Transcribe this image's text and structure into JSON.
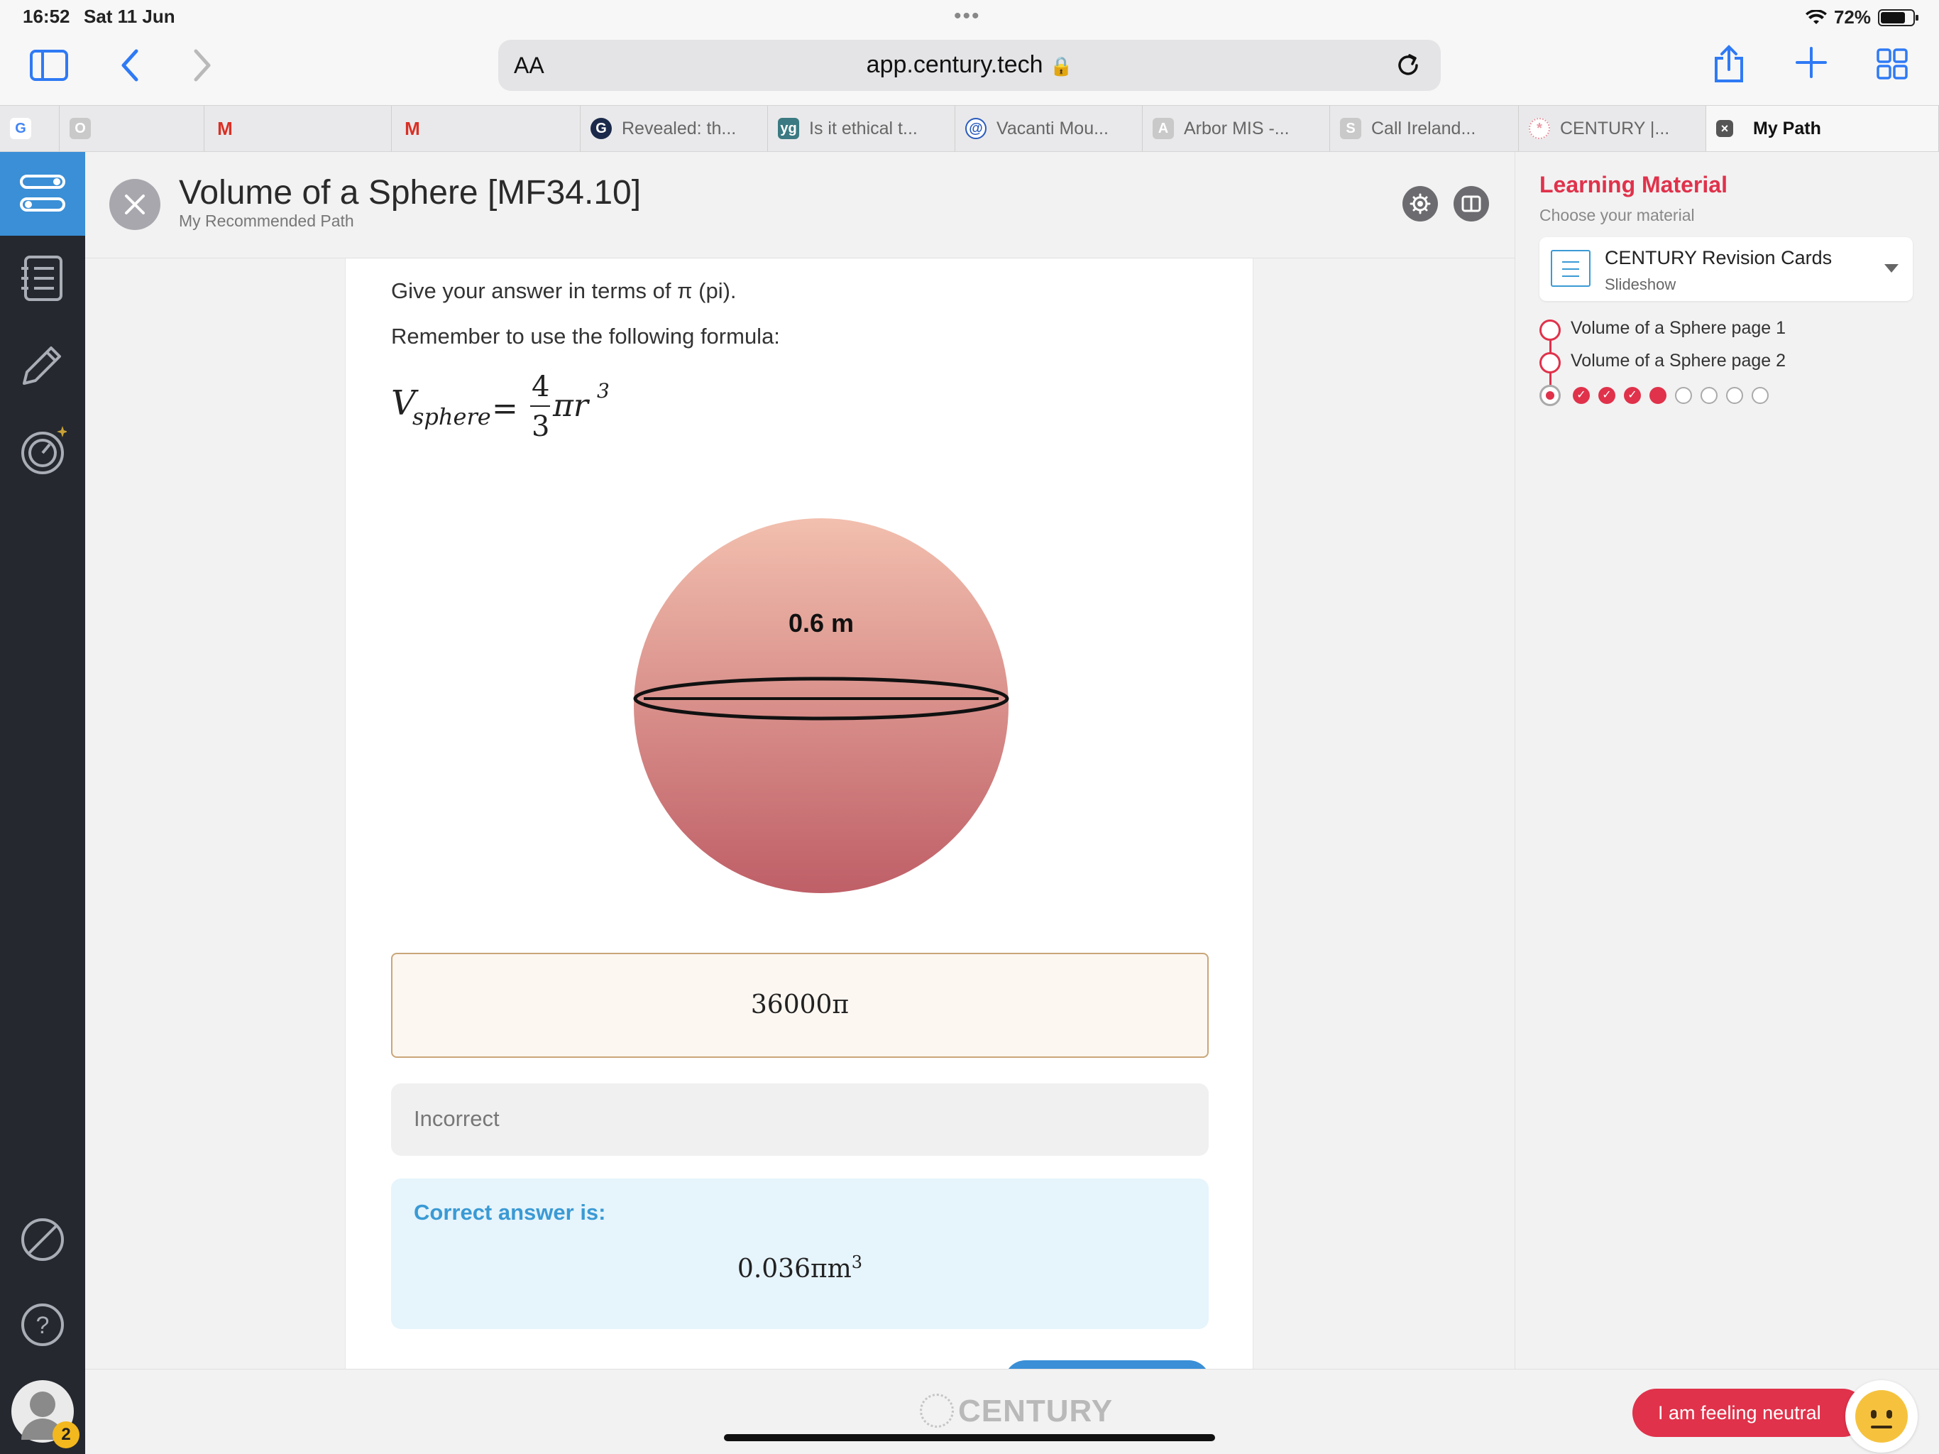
{
  "status": {
    "time": "16:52",
    "date": "Sat 11 Jun",
    "battery": "72%"
  },
  "browser": {
    "aa_label": "AA",
    "url": "app.century.tech",
    "tabs": [
      {
        "label": "",
        "fav": "G",
        "fav_color": "#ffffff"
      },
      {
        "label": "",
        "fav": "O",
        "fav_color": "#bdbdbd"
      },
      {
        "label": "",
        "fav": "M",
        "fav_color": "#ffffff"
      },
      {
        "label": "",
        "fav": "M",
        "fav_color": "#ffffff"
      },
      {
        "label": "Revealed: th...",
        "fav": "G",
        "fav_color": "#1b2a4a"
      },
      {
        "label": "Is it ethical t...",
        "fav": "yg",
        "fav_color": "#3b7a82"
      },
      {
        "label": "Vacanti Mou...",
        "fav": "@",
        "fav_color": "#2a5bbd"
      },
      {
        "label": "Arbor MIS -...",
        "fav": "A",
        "fav_color": "#bdbdbd"
      },
      {
        "label": "Call Ireland...",
        "fav": "S",
        "fav_color": "#bdbdbd"
      },
      {
        "label": "CENTURY |...",
        "fav": "*",
        "fav_color": "#e89aa5"
      },
      {
        "label": "My Path",
        "fav": "x",
        "fav_color": "#555555"
      }
    ]
  },
  "header": {
    "title": "Volume of a Sphere [MF34.10]",
    "subtitle": "My Recommended Path"
  },
  "question": {
    "line1": "Give your answer in terms of π (pi).",
    "line2": "Remember to use the following formula:",
    "formula_lhs": "V",
    "formula_sub": "sphere",
    "formula_num": "4",
    "formula_den": "3",
    "formula_rest": "πr",
    "formula_exp": "3",
    "diagram_label": "0.6 m"
  },
  "answer": {
    "user_answer": "36000π",
    "feedback": "Incorrect",
    "correct_label": "Correct answer is:",
    "correct_value": "0.036πm",
    "correct_exp": "3"
  },
  "panel": {
    "title": "Learning Material",
    "subtitle": "Choose your material",
    "material_name": "CENTURY Revision Cards",
    "material_type": "Slideshow",
    "items": [
      "Volume of a Sphere page 1",
      "Volume of a Sphere page 2"
    ],
    "progress": {
      "completed": 3,
      "current_index": 3,
      "total": 8
    }
  },
  "footer": {
    "logo": "CENTURY",
    "feeling": "I am feeling neutral",
    "notifications": "2"
  },
  "colors": {
    "accent": "#e0324b",
    "blue": "#3a8fd7",
    "sidebar": "#25282f"
  }
}
